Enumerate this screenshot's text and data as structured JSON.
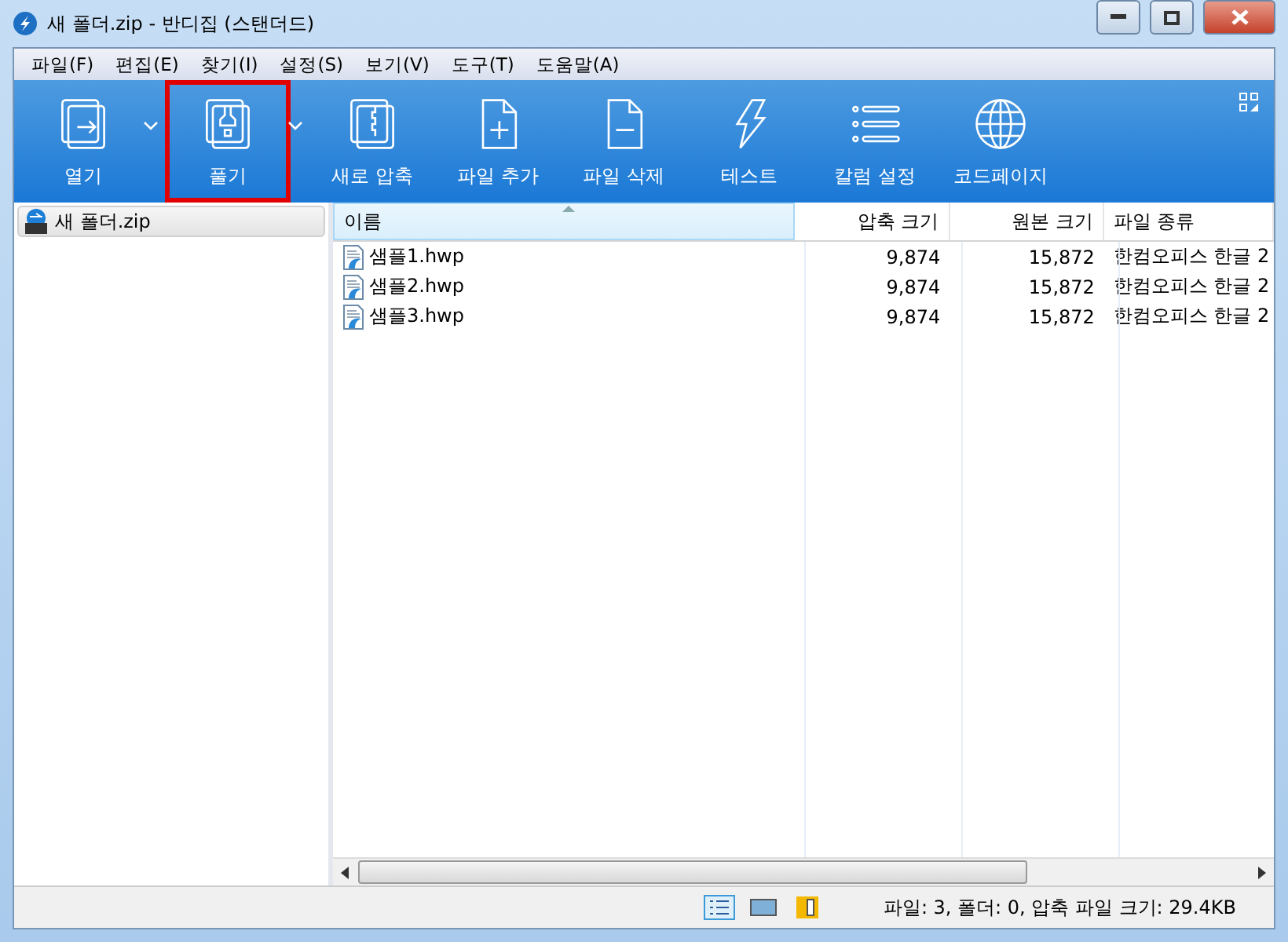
{
  "window": {
    "title": "새 폴더.zip - 반디집 (스탠더드)"
  },
  "menu": [
    "파일(F)",
    "편집(E)",
    "찾기(I)",
    "설정(S)",
    "보기(V)",
    "도구(T)",
    "도움말(A)"
  ],
  "toolbar": [
    {
      "label": "열기",
      "dropdown": true,
      "highlighted": false
    },
    {
      "label": "풀기",
      "dropdown": true,
      "highlighted": true
    },
    {
      "label": "새로 압축",
      "dropdown": false,
      "highlighted": false
    },
    {
      "label": "파일 추가",
      "dropdown": false,
      "highlighted": false
    },
    {
      "label": "파일 삭제",
      "dropdown": false,
      "highlighted": false
    },
    {
      "label": "테스트",
      "dropdown": false,
      "highlighted": false
    },
    {
      "label": "칼럼 설정",
      "dropdown": false,
      "highlighted": false
    },
    {
      "label": "코드페이지",
      "dropdown": false,
      "highlighted": false
    }
  ],
  "tree": [
    {
      "label": "새 폴더.zip",
      "selected": true
    }
  ],
  "table": {
    "columns": [
      "이름",
      "압축 크기",
      "원본 크기",
      "파일 종류"
    ],
    "rows": [
      [
        "샘플1.hwp",
        "9,874",
        "15,872",
        "한컴오피스 한글 2"
      ],
      [
        "샘플2.hwp",
        "9,874",
        "15,872",
        "한컴오피스 한글 2"
      ],
      [
        "샘플3.hwp",
        "9,874",
        "15,872",
        "한컴오피스 한글 2"
      ]
    ]
  },
  "status_bar": {
    "text": "파일: 3, 폴더: 0, 압축 파일 크기: 29.4KB"
  }
}
